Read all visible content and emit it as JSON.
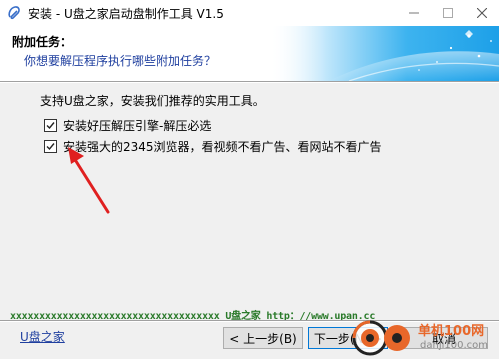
{
  "window": {
    "title": "安装 - U盘之家启动盘制作工具 V1.5",
    "minimize_icon": "minimize-icon",
    "maximize_icon": "maximize-icon",
    "close_icon": "close-icon"
  },
  "header": {
    "title": "附加任务：",
    "subtitle": "你想要解压程序执行哪些附加任务？"
  },
  "body": {
    "intro": "支持U盘之家，安装我们推荐的实用工具。",
    "options": [
      {
        "label": "安装好压解压引擎-解压必选",
        "checked": true
      },
      {
        "label": "安装强大的2345浏览器，看视频不看广告、看网站不看广告",
        "checked": true
      }
    ]
  },
  "footer": {
    "brand_line": "xxxxxxxxxxxxxxxxxxxxxxxxxxxxxxxxxxxx U盘之家 http：//www.upan.cc",
    "link": "U盘之家",
    "back_button": "< 上一步(B)",
    "next_button": "下一步(N) >",
    "cancel_button": "取消"
  },
  "watermark": {
    "site_name": "单机100网",
    "site_url": "danji100.com"
  },
  "colors": {
    "accent_blue": "#1f3f9f",
    "header_gradient": "#1da0e8",
    "arrow_red": "#e02020",
    "brand_green": "#2a7a2a",
    "watermark_orange": "#e8672a"
  }
}
